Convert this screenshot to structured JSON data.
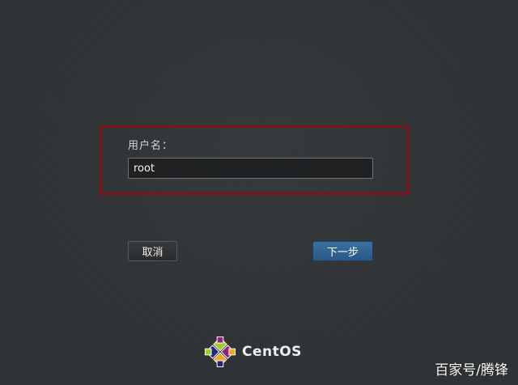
{
  "login_form": {
    "username_label": "用户名：",
    "username_value": "root",
    "highlight_color": "#7e1416"
  },
  "buttons": {
    "cancel_label": "取消",
    "next_label": "下一步",
    "next_color": "#2f6290"
  },
  "branding": {
    "logo_text": "CentOS",
    "logo_icon": "centos-logo-icon"
  },
  "watermark": {
    "text": "百家号/腾锋"
  }
}
